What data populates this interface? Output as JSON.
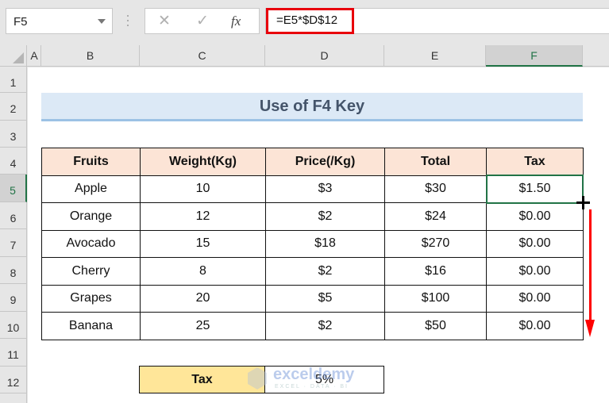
{
  "formula_bar": {
    "name_box": "F5",
    "cancel_icon": "✕",
    "enter_icon": "✓",
    "fx_label": "fx",
    "formula": "=E5*$D$12"
  },
  "columns": [
    "A",
    "B",
    "C",
    "D",
    "E",
    "F"
  ],
  "selected_column": "F",
  "rows": [
    "1",
    "2",
    "3",
    "4",
    "5",
    "6",
    "7",
    "8",
    "9",
    "10",
    "11",
    "12"
  ],
  "selected_row": "5",
  "sheet": {
    "title": "Use of F4 Key",
    "table": {
      "headers": [
        "Fruits",
        "Weight(Kg)",
        "Price(/Kg)",
        "Total",
        "Tax"
      ],
      "rows": [
        [
          "Apple",
          "10",
          "$3",
          "$30",
          "$1.50"
        ],
        [
          "Orange",
          "12",
          "$2",
          "$24",
          "$0.00"
        ],
        [
          "Avocado",
          "15",
          "$18",
          "$270",
          "$0.00"
        ],
        [
          "Cherry",
          "8",
          "$2",
          "$16",
          "$0.00"
        ],
        [
          "Grapes",
          "20",
          "$5",
          "$100",
          "$0.00"
        ],
        [
          "Banana",
          "25",
          "$2",
          "$50",
          "$0.00"
        ]
      ]
    },
    "tax_rate": {
      "label": "Tax",
      "value": "5%"
    },
    "watermark": {
      "name": "exceldemy",
      "tagline": "EXCEL · DATA · BI"
    }
  },
  "colors": {
    "selection": "#217346",
    "highlight": "#e8000b",
    "header_fill": "#fce4d6",
    "title_fill": "#dce9f6",
    "tax_label_fill": "#ffe699"
  }
}
